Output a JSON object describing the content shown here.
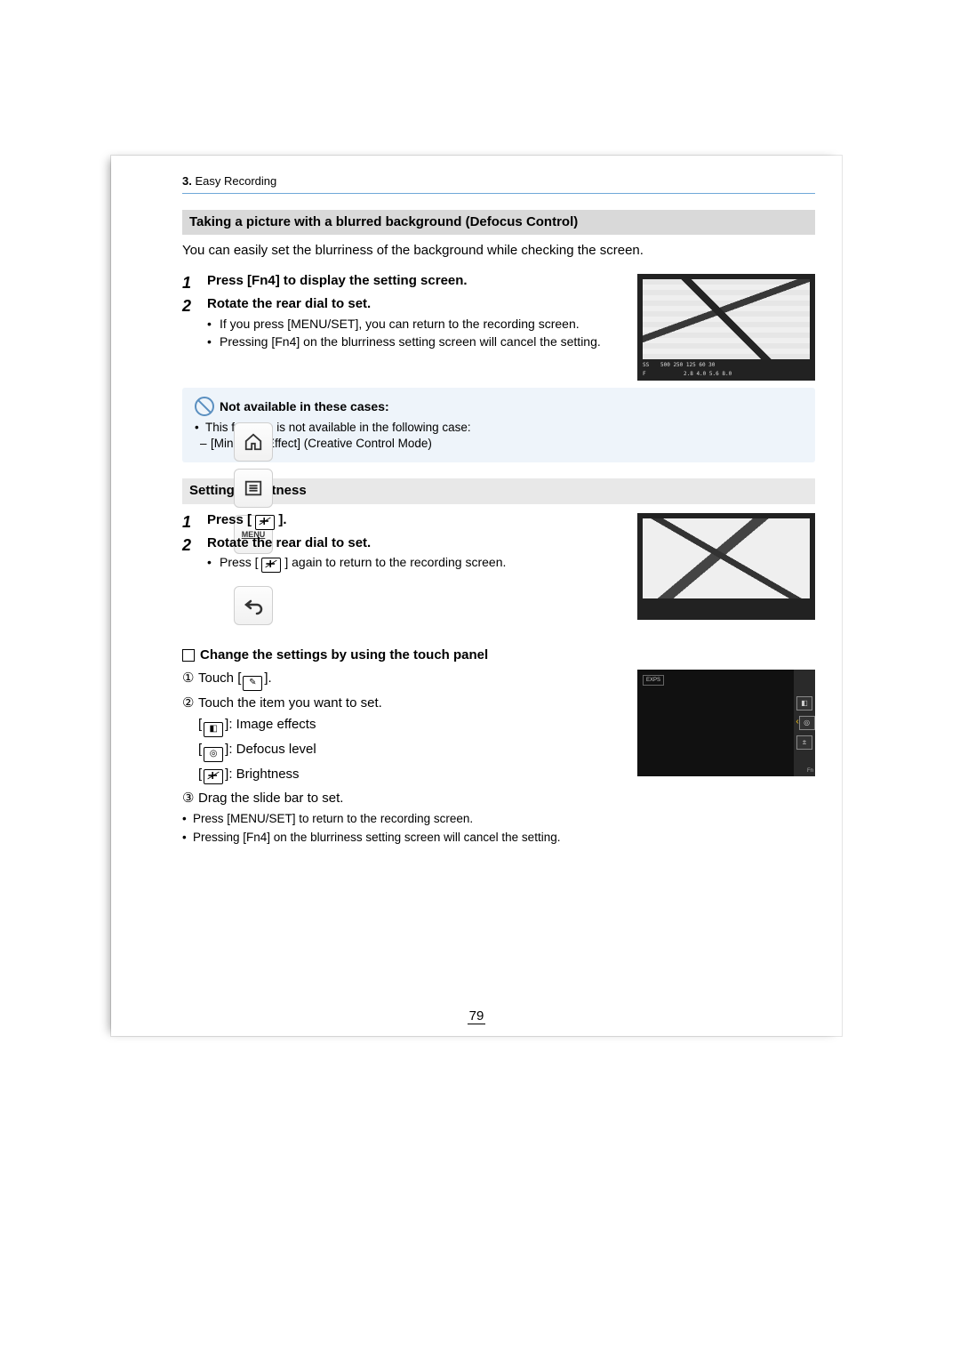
{
  "sidebar": {
    "menu_label": "MENU"
  },
  "breadcrumb": {
    "chapter_no": "3.",
    "chapter_title": " Easy Recording"
  },
  "section1": {
    "title": "Taking a picture with a blurred background (Defocus Control)",
    "intro": "You can easily set the blurriness of the background while checking the screen.",
    "step1": "Press [Fn4] to display the setting screen.",
    "step2": "Rotate the rear dial to set.",
    "bullet1": "If you press [MENU/SET], you can return to the recording screen.",
    "bullet2": "Pressing [Fn4] on the blurriness setting screen will cancel the setting.",
    "illus": {
      "ss_label": "SS",
      "ss_values": "500  250  125   60   30",
      "f_label": "F",
      "f_values": "2.8   4.0   5.6   8.0"
    }
  },
  "notebox": {
    "heading": "Not available in these cases:",
    "line1": "This function is not available in the following case:",
    "dash1": "[Miniature Effect] (Creative Control Mode)"
  },
  "section2": {
    "title": "Setting brightness",
    "step1_pre": "Press [ ",
    "step1_post": " ].",
    "step2": "Rotate the rear dial to set.",
    "bullet1_pre": "Press [ ",
    "bullet1_post": " ] again to return to the recording screen."
  },
  "touch": {
    "heading": "Change the settings by using the touch panel",
    "step1_pre": "Touch [",
    "step1_post": "].",
    "step2": "Touch the item you want to set.",
    "item1": "]: Image effects",
    "item2": "]: Defocus level",
    "item3": "]: Brightness",
    "drag": "Drag the slide bar to set.",
    "b1": "Press [MENU/SET] to return to the recording screen.",
    "b2": "Pressing [Fn4] on the blurriness setting screen will cancel the setting.",
    "illus_label": "EXPS",
    "illus_fn": "Fn"
  },
  "numbers": {
    "one": "1",
    "two": "2",
    "three": "3"
  },
  "page_number": "79"
}
